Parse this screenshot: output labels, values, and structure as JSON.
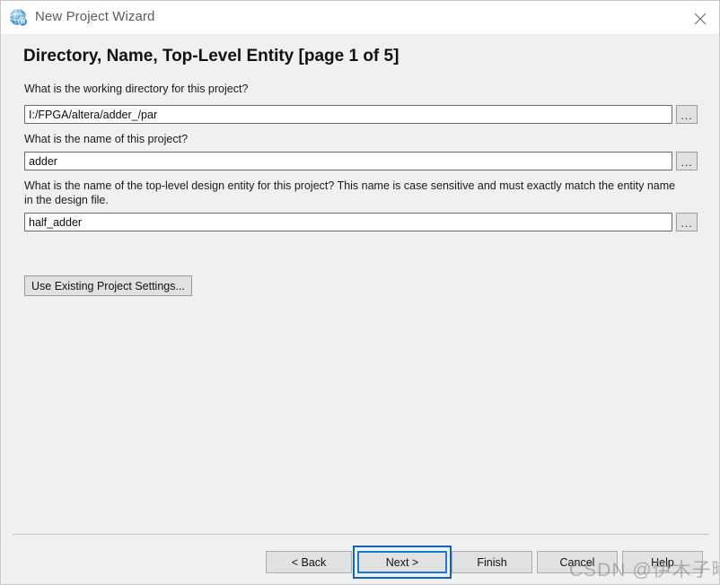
{
  "window": {
    "title": "New Project Wizard",
    "icon": "globe-icon",
    "close_label": "✕"
  },
  "page": {
    "heading": "Directory, Name, Top-Level Entity [page 1 of 5]"
  },
  "fields": [
    {
      "label": "What is the working directory for this project?",
      "value": "I:/FPGA/altera/adder_/par",
      "placeholder": "",
      "browse_label": "..."
    },
    {
      "label": "What is the name of this project?",
      "value": "adder",
      "placeholder": "",
      "browse_label": "..."
    },
    {
      "label": "What is the name of the top-level design entity for this project? This name is case sensitive and must exactly match the entity name in the design file.",
      "value": "half_adder",
      "placeholder": "",
      "browse_label": "..."
    }
  ],
  "actions": {
    "use_existing_label": "Use Existing Project Settings..."
  },
  "footer": {
    "back_label": "< Back",
    "next_label": "Next >",
    "finish_label": "Finish",
    "cancel_label": "Cancel",
    "help_label": "Help"
  },
  "watermark": {
    "text": "CSDN @伊木子曦"
  },
  "colors": {
    "focus_border": "#1779d8",
    "focus_ring": "#1060c0",
    "dialog_bg": "#f0f0f0",
    "titlebar_bg": "#ffffff",
    "input_border": "#6b6b6b",
    "button_bg": "#e1e1e1"
  }
}
